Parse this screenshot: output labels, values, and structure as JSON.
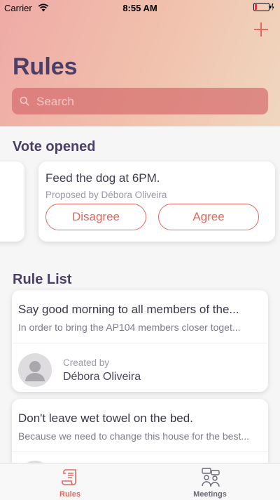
{
  "status_bar": {
    "carrier": "Carrier",
    "time": "8:55 AM"
  },
  "header": {
    "title": "Rules",
    "add_icon": "plus-icon",
    "search_placeholder": "Search"
  },
  "vote_section": {
    "title": "Vote opened",
    "card": {
      "title": "Feed the dog at 6PM.",
      "proposed_by": "Proposed by Débora Oliveira",
      "disagree_label": "Disagree",
      "agree_label": "Agree"
    }
  },
  "rule_section": {
    "title": "Rule List",
    "rules": [
      {
        "title": "Say good morning to all members of the...",
        "description": "In order to bring the AP104 members closer toget...",
        "created_label": "Created by",
        "creator": "Débora Oliveira"
      },
      {
        "title": "Don't leave wet towel on the bed.",
        "description": "Because we need to change this house for the best..."
      }
    ]
  },
  "tabbar": {
    "tabs": [
      {
        "label": "Rules",
        "icon": "scroll-icon",
        "active": true
      },
      {
        "label": "Meetings",
        "icon": "meeting-people-icon",
        "active": false
      }
    ]
  },
  "colors": {
    "accent": "#e5675d",
    "title": "#4b3f66"
  }
}
